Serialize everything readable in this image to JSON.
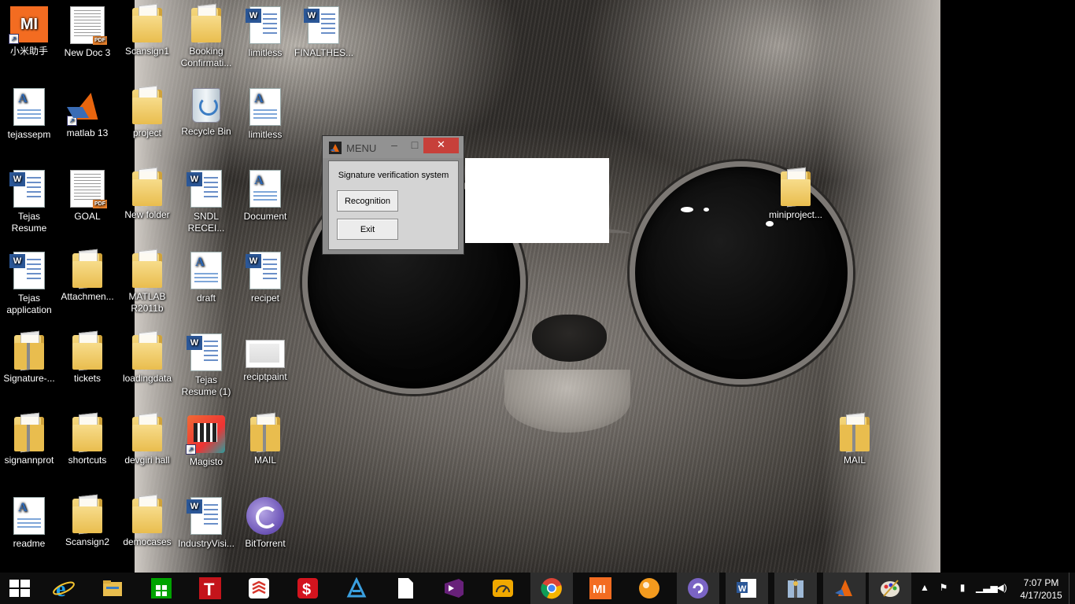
{
  "desktop": {
    "icons": [
      {
        "label": "小米助手",
        "icon": "mi-assistant-icon"
      },
      {
        "label": "New Doc 3",
        "icon": "pdf-document-icon"
      },
      {
        "label": "Scansign1",
        "icon": "folder-icon"
      },
      {
        "label": "Booking\nConfirmati...",
        "icon": "folder-icon"
      },
      {
        "label": "limitless",
        "icon": "word-document-icon"
      },
      {
        "label": "FINALTHES...",
        "icon": "word-document-icon"
      },
      {
        "label": "tejassepm",
        "icon": "text-document-icon"
      },
      {
        "label": "matlab 13",
        "icon": "matlab-icon"
      },
      {
        "label": "project",
        "icon": "folder-icon"
      },
      {
        "label": "Recycle Bin",
        "icon": "recycle-bin-icon"
      },
      {
        "label": "limitless",
        "icon": "text-document-icon"
      },
      {
        "label": "Tejas\nResume",
        "icon": "word-document-icon"
      },
      {
        "label": "GOAL",
        "icon": "pdf-document-icon"
      },
      {
        "label": "New folder",
        "icon": "folder-icon"
      },
      {
        "label": "SNDL\nRECEI...",
        "icon": "word-document-icon"
      },
      {
        "label": "Document",
        "icon": "text-document-icon"
      },
      {
        "label": "Tejas\napplication",
        "icon": "word-document-icon"
      },
      {
        "label": "Attachmen...",
        "icon": "folder-icon"
      },
      {
        "label": "MATLAB\nR2011b",
        "icon": "folder-icon"
      },
      {
        "label": "draft",
        "icon": "text-document-icon"
      },
      {
        "label": "recipet",
        "icon": "word-document-icon"
      },
      {
        "label": "Signature-...",
        "icon": "zip-folder-icon"
      },
      {
        "label": "tickets",
        "icon": "folder-icon"
      },
      {
        "label": "loadingdata",
        "icon": "folder-icon"
      },
      {
        "label": "Tejas\nResume (1)",
        "icon": "word-document-icon"
      },
      {
        "label": "reciptpaint",
        "icon": "image-icon"
      },
      {
        "label": "signannprot",
        "icon": "zip-folder-icon"
      },
      {
        "label": "shortcuts",
        "icon": "folder-icon"
      },
      {
        "label": "devgiri hall",
        "icon": "folder-icon"
      },
      {
        "label": "Magisto",
        "icon": "magisto-icon"
      },
      {
        "label": "MAIL",
        "icon": "zip-folder-icon"
      },
      {
        "label": "readme",
        "icon": "text-document-icon"
      },
      {
        "label": "Scansign2",
        "icon": "folder-icon"
      },
      {
        "label": "democases",
        "icon": "folder-icon"
      },
      {
        "label": "IndustryVisi...",
        "icon": "word-document-icon"
      },
      {
        "label": "BitTorrent",
        "icon": "bittorrent-icon"
      },
      {
        "label": "miniproject...",
        "icon": "folder-icon"
      },
      {
        "label": "MAIL",
        "icon": "zip-folder-icon"
      }
    ]
  },
  "menu_window": {
    "title": "MENU",
    "minimize": "–",
    "maximize": "□",
    "close": "✕",
    "heading": "Signature verification system",
    "recognition_label": "Recognition",
    "exit_label": "Exit"
  },
  "taskbar": {
    "apps": [
      "start-icon",
      "internet-explorer-icon",
      "file-explorer-icon",
      "store-icon",
      "tally-icon",
      "todoist-icon",
      "dollar-app-icon",
      "azure-icon",
      "blank-document-icon",
      "visual-studio-icon",
      "speedometer-icon",
      "chrome-icon",
      "mi-icon",
      "ball-app-icon",
      "bittorrent-icon",
      "word-icon",
      "winzip-icon",
      "matlab-icon",
      "paint-icon"
    ],
    "clock_time": "7:07 PM",
    "clock_date": "4/17/2015",
    "accent_close": "#c7403a"
  }
}
